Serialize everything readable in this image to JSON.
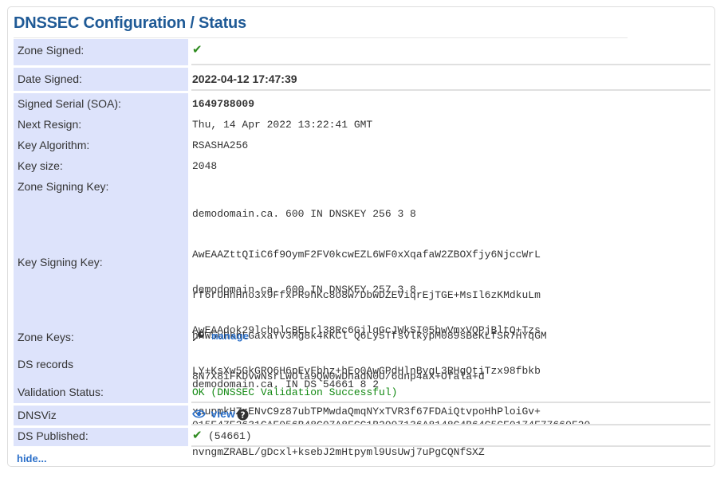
{
  "title": "DNSSEC Configuration / Status",
  "rows": {
    "zone_signed": {
      "label": "Zone Signed:",
      "value_icon": "checkmark-icon"
    },
    "date_signed": {
      "label": "Date Signed:",
      "value": "2022-04-12 17:47:39"
    },
    "signed_serial": {
      "label": "Signed Serial (SOA):",
      "value": "1649788009"
    },
    "next_resign": {
      "label": "Next Resign:",
      "value": "Thu, 14 Apr 2022 13:22:41 GMT"
    },
    "key_algorithm": {
      "label": "Key Algorithm:",
      "value": "RSASHA256"
    },
    "key_size": {
      "label": "Key size:",
      "value": "2048"
    },
    "zsk": {
      "label": "Zone Signing Key:",
      "lines": [
        "demodomain.ca. 600 IN DNSKEY 256 3 8",
        "AwEAAZttQIiC6f9OymF2FV0kcwEZL6WF0xXqafaW2ZBOXfjy6NjccWrL",
        "rf6rUHhHno3x9FfxPR9hKc8o8w/DbwDZEViqrEjTGE+MsIl6zKMdkuLm",
        "hHW5uHknLGaxaYV3Mg8k4kKCl Q6Ly5TfsVlkypM089sBeKLfSR7HYqGM",
        "8N7X8iFKDvwNsrLWOla9QW0wDhadN0U/6dnp4aX+Ofala+d"
      ]
    },
    "ksk": {
      "label": "Key Signing Key:",
      "lines": [
        "demodomain.ca. 600 IN DNSKEY 257 3 8",
        "AwEAAdok29lcholcBELrl38Rc6GjlqGcJWkSI05bwVmxVQPjBltQ+Tzs",
        "LY+KsXw5GkGRO6H6pEvFbhz+hEo0AwGPdHlnBygL3RHgOtiTzx98fbkb",
        "xaupmkHZrENvC9z87ubTPMwdaQmqNYxTVR3f67FDAiQtvpoHhPloiGv+",
        "nvngmZRABL/gDcxl+ksebJ2mHtpyml9UsUwj7uPgCQNfSXZ"
      ]
    },
    "zone_keys": {
      "label": "Zone Keys:",
      "link": "manage",
      "icon": "key-icon"
    },
    "ds_records": {
      "label": "DS records",
      "lines": [
        "demodomain.ca. IN DS 54661 8 2",
        "015E47E2631CAE056B48C07A8FCC1B2997136A8148C4B64C5CE0174E77669F20"
      ]
    },
    "validation_status": {
      "label": "Validation Status:",
      "value": "OK (DNSSEC Validation Successful)"
    },
    "dnsviz": {
      "label": "DNSViz",
      "link": "view",
      "icon": "eye-icon",
      "help_icon": "question-circle-icon"
    },
    "ds_published": {
      "label": "DS Published:",
      "value": "(54661)",
      "icon": "checkmark-icon"
    }
  },
  "hide_link": "hide...",
  "colors": {
    "title": "#1f5a96",
    "label_bg": "#dde3fb",
    "link": "#2a6fc9",
    "ok": "#118811",
    "check": "#2e8b1f"
  }
}
